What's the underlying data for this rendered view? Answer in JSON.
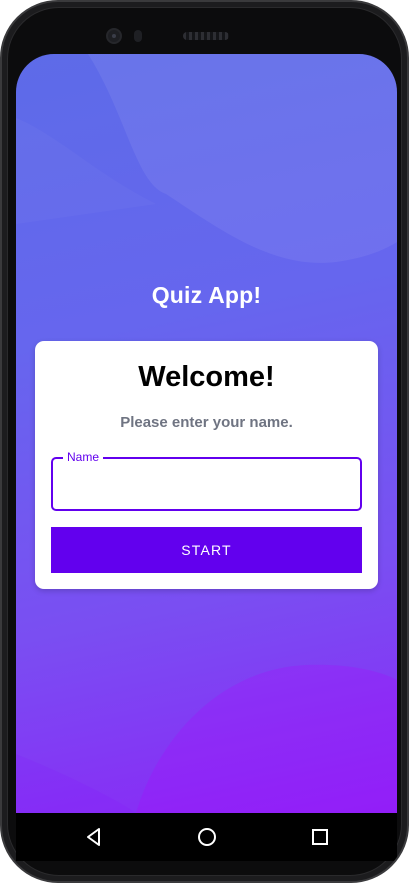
{
  "app": {
    "title": "Quiz App!"
  },
  "card": {
    "heading": "Welcome!",
    "subtitle": "Please enter your name.",
    "name_field": {
      "label": "Name",
      "value": ""
    },
    "start_label": "START"
  },
  "navbar": {
    "icons": [
      "back-icon",
      "home-icon",
      "recents-icon"
    ]
  },
  "colors": {
    "accent": "#6200ee",
    "gradient_top": "#5d6be8",
    "gradient_bottom": "#8a26f6",
    "subtitle": "#6f7482"
  }
}
